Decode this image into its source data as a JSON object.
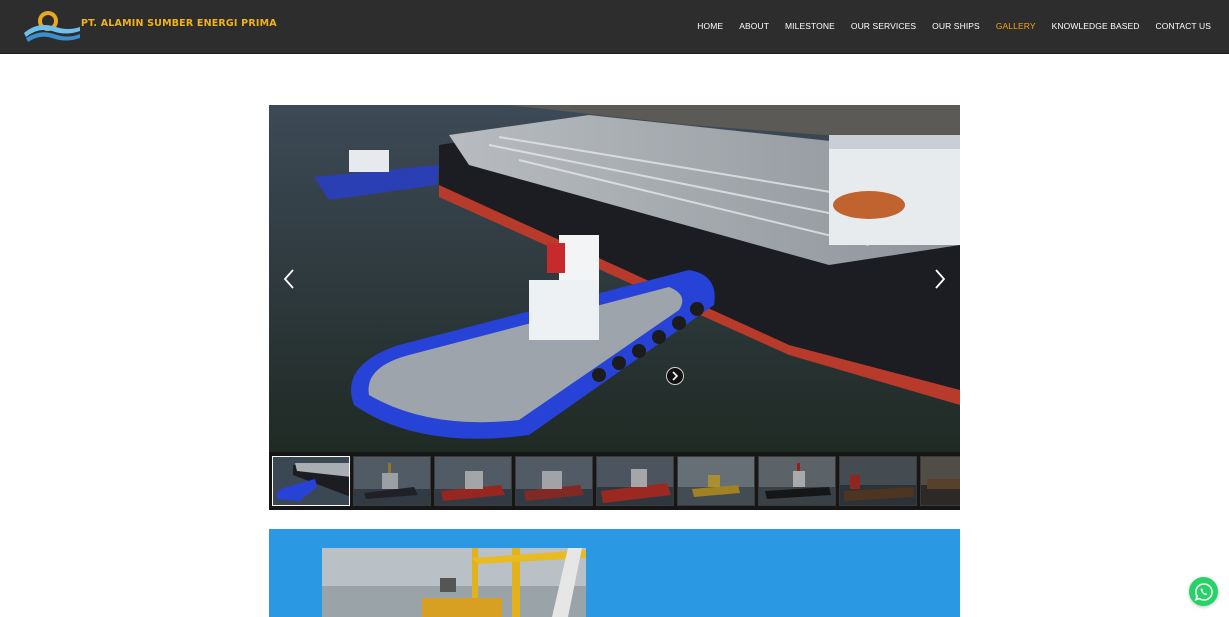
{
  "header": {
    "brand": "PT. ALAMIN SUMBER ENERGI PRIMA",
    "logo_icon": "sun-wave-logo-icon"
  },
  "nav": [
    {
      "label": "HOME",
      "active": false
    },
    {
      "label": "ABOUT",
      "active": false
    },
    {
      "label": "MILESTONE",
      "active": false
    },
    {
      "label": "OUR SERVICES",
      "active": false
    },
    {
      "label": "OUR SHIPS",
      "active": false
    },
    {
      "label": "GALLERY",
      "active": true
    },
    {
      "label": "KNOWLEDGE BASED",
      "active": false
    },
    {
      "label": "CONTACT US",
      "active": false
    }
  ],
  "gallery": {
    "prev_icon": "chevron-left-icon",
    "next_icon": "chevron-right-icon",
    "thumbs_next_icon": "circle-chevron-right-icon",
    "thumbnail_count_visible": 9,
    "current_index": 0
  },
  "colors": {
    "header_bg": "#2d2d2d",
    "brand": "#f2b318",
    "nav_active": "#f2a519",
    "panel_blue": "#2b98e4",
    "whatsapp": "#25d366"
  },
  "floating": {
    "whatsapp_icon": "whatsapp-icon"
  }
}
